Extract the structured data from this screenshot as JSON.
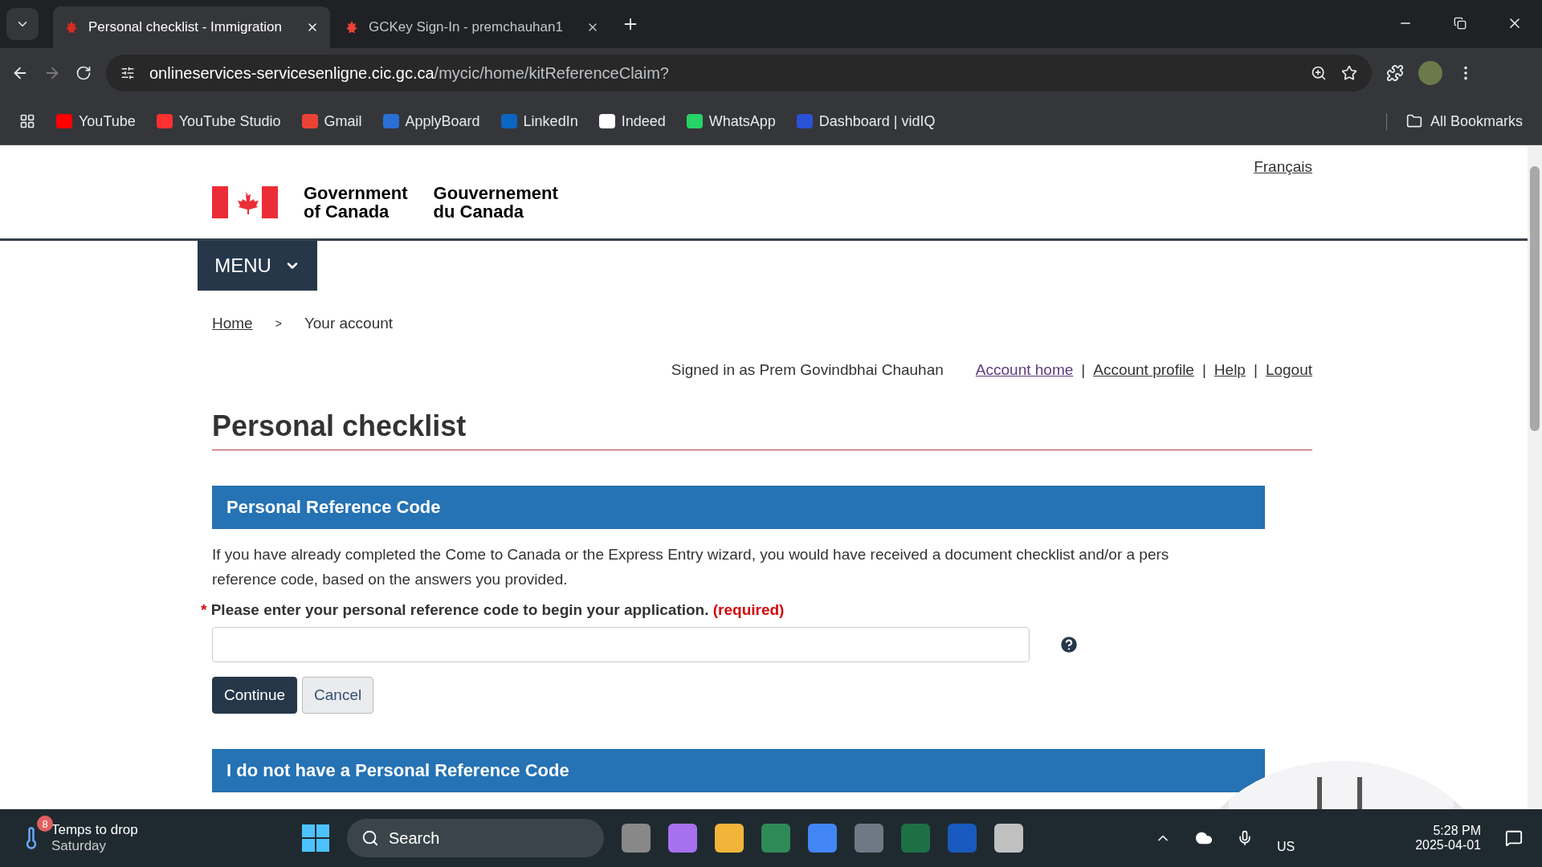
{
  "browser": {
    "tabs": [
      {
        "title": "Personal checklist - Immigration",
        "selected": true
      },
      {
        "title": "GCKey Sign-In - premchauhan1",
        "selected": false
      }
    ],
    "url": {
      "host": "onlineservices-servicesenligne.cic.gc.ca",
      "path": "/mycic/home/kitReferenceClaim?"
    },
    "bookmarks": [
      "YouTube",
      "YouTube Studio",
      "Gmail",
      "ApplyBoard",
      "LinkedIn",
      "Indeed",
      "WhatsApp",
      "Dashboard | vidIQ"
    ],
    "all_bookmarks": "All Bookmarks"
  },
  "page": {
    "language_link": "Français",
    "signature": {
      "en": [
        "Government",
        "of Canada"
      ],
      "fr": [
        "Gouvernement",
        "du Canada"
      ]
    },
    "menu": "MENU",
    "breadcrumb_separator": ">",
    "link_separator": "|",
    "breadcrumbs": [
      {
        "label": "Home",
        "link": true
      },
      {
        "label": "Your account",
        "link": false
      }
    ],
    "signed_in": "Signed in as Prem Govindbhai Chauhan",
    "account_links": [
      "Account home",
      "Account profile",
      "Help",
      "Logout"
    ],
    "title": "Personal checklist",
    "sections": [
      {
        "heading": "Personal Reference Code",
        "lines": [
          "If you have already completed the Come to Canada or the Express Entry wizard, you would have received a document checklist and/or a pers",
          "reference code, based on the answers you provided."
        ],
        "field": {
          "marker": "*",
          "label": "Please enter your personal reference code to begin your application.",
          "required": "(required)"
        },
        "buttons": [
          {
            "label": "Continue",
            "kind": "primary"
          },
          {
            "label": "Cancel",
            "kind": "secondary"
          }
        ]
      },
      {
        "heading": "I do not have a Personal Reference Code"
      }
    ]
  },
  "taskbar": {
    "weather": {
      "badge": "8",
      "title": "Temps to drop",
      "subtitle": "Saturday"
    },
    "search": "Search",
    "language": "US",
    "time": "5:28 PM",
    "date": "2025-04-01"
  }
}
